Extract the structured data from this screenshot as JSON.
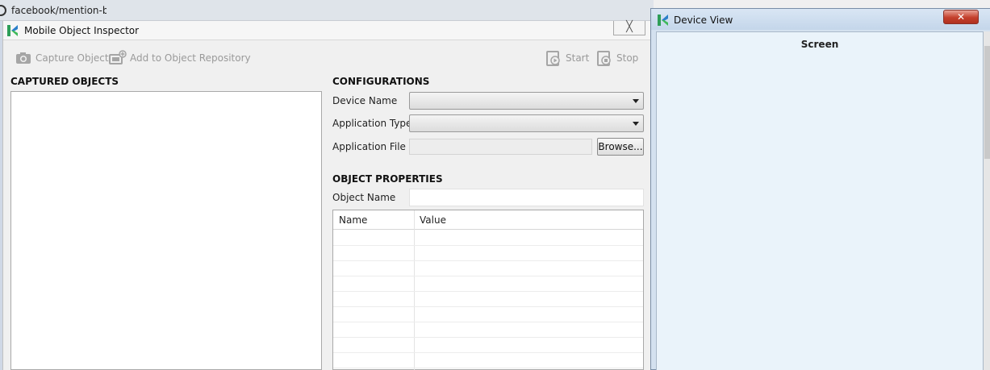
{
  "background_window": {
    "title": "facebook/mention-bc"
  },
  "inspector": {
    "title": "Mobile Object Inspector",
    "close_label": "╳",
    "toolbar": {
      "capture": "Capture Object",
      "add_repo": "Add to Object Repository",
      "start": "Start",
      "stop": "Stop"
    },
    "captured_objects": {
      "heading": "CAPTURED OBJECTS",
      "items": []
    },
    "configurations": {
      "heading": "CONFIGURATIONS",
      "device_name_label": "Device Name",
      "device_name_value": "",
      "application_type_label": "Application Type",
      "application_type_value": "",
      "application_file_label": "Application File",
      "application_file_value": "",
      "browse_button": "Browse..."
    },
    "object_properties": {
      "heading": "OBJECT PROPERTIES",
      "object_name_label": "Object Name",
      "object_name_value": "",
      "columns": [
        "Name",
        "Value"
      ],
      "rows": []
    }
  },
  "device_view": {
    "title": "Device View",
    "close_label": "✕",
    "screen_label": "Screen"
  },
  "colors": {
    "accent_green": "#2e9e58",
    "close_red": "#c4402c"
  }
}
